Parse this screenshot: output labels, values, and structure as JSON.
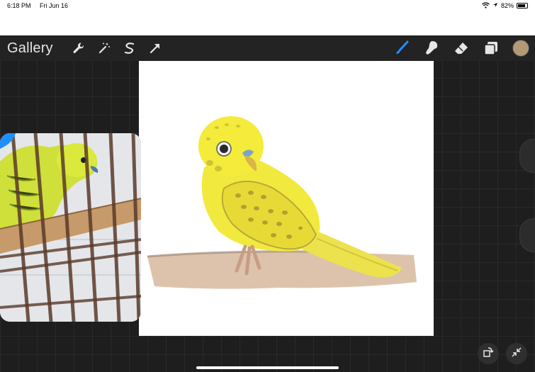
{
  "status_bar": {
    "time": "6:18 PM",
    "date": "Fri Jun 16",
    "battery_text": "82%",
    "battery_level": 0.82
  },
  "toolbar": {
    "gallery_label": "Gallery",
    "left_tools": [
      "wrench-icon",
      "magic-wand-icon",
      "selection-icon",
      "transform-arrow-icon"
    ],
    "right_tools": [
      "brush-icon",
      "smudge-icon",
      "eraser-icon",
      "layers-icon"
    ],
    "active_tool": "brush-icon",
    "current_color": "#b49a74",
    "accent_color": "#1e8fff"
  },
  "canvas": {
    "background": "#ffffff"
  },
  "reference_window": {
    "subject": "budgie-in-cage-photo"
  }
}
